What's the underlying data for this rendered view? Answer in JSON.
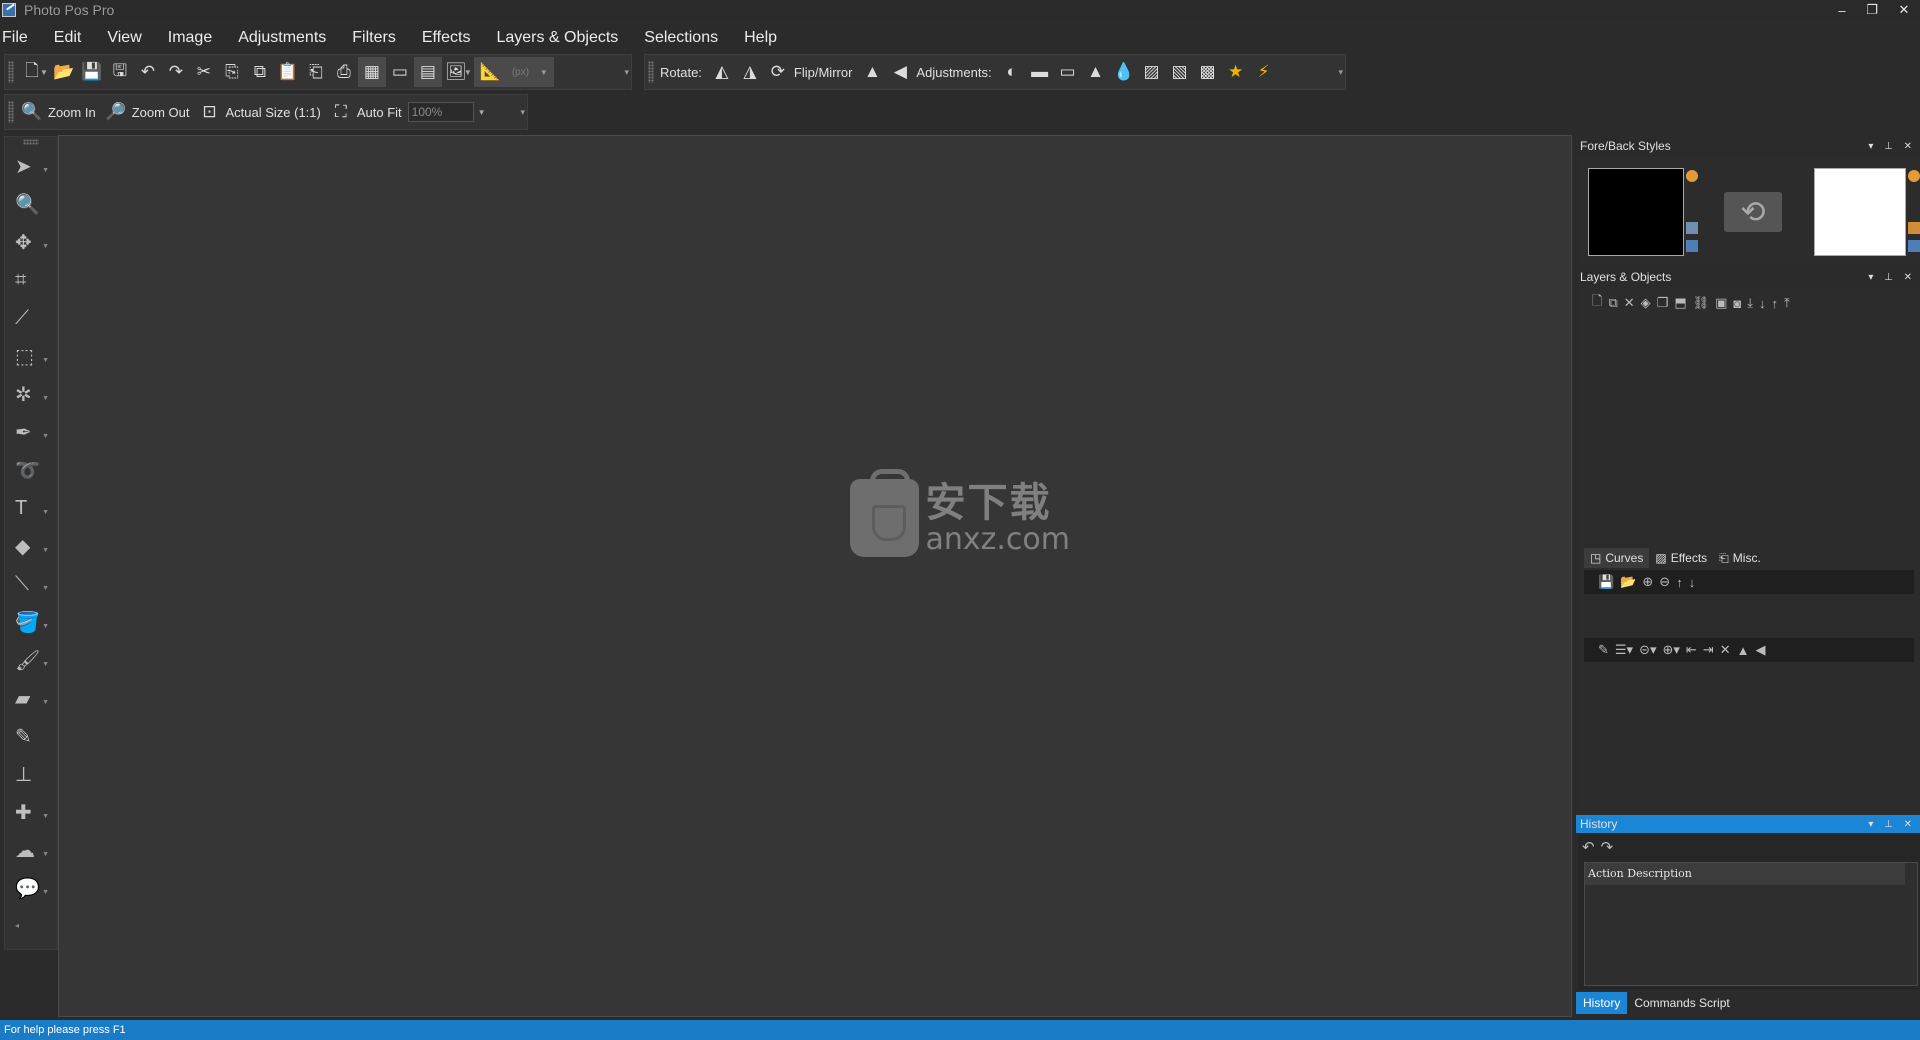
{
  "window": {
    "title": "Photo Pos Pro",
    "controls": {
      "minimize": "–",
      "restore": "❐",
      "close": "✕"
    }
  },
  "menu": [
    "File",
    "Edit",
    "View",
    "Image",
    "Adjustments",
    "Filters",
    "Effects",
    "Layers & Objects",
    "Selections",
    "Help"
  ],
  "toolbar": {
    "rotate_label": "Rotate:",
    "flip_label": "Flip/Mirror",
    "adjustments_label": "Adjustments:",
    "unit_value": "(px)"
  },
  "zoombar": {
    "zoom_in": "Zoom In",
    "zoom_out": "Zoom Out",
    "actual_size": "Actual Size (1:1)",
    "auto_fit": "Auto Fit",
    "zoom_value": "100%"
  },
  "watermark": {
    "chinese": "安下载",
    "domain": "anxz.com"
  },
  "panels": {
    "fore_back": "Fore/Back Styles",
    "layers": "Layers & Objects",
    "subtabs": [
      "Curves",
      "Effects",
      "Misc."
    ],
    "history": "History",
    "history_column": "Action Description",
    "bottom_tabs": [
      "History",
      "Commands Script"
    ]
  },
  "colors": {
    "accent": "#1c86d6",
    "foreground_swatch": "#000000",
    "background_swatch": "#ffffff"
  },
  "status": "For help please press F1"
}
